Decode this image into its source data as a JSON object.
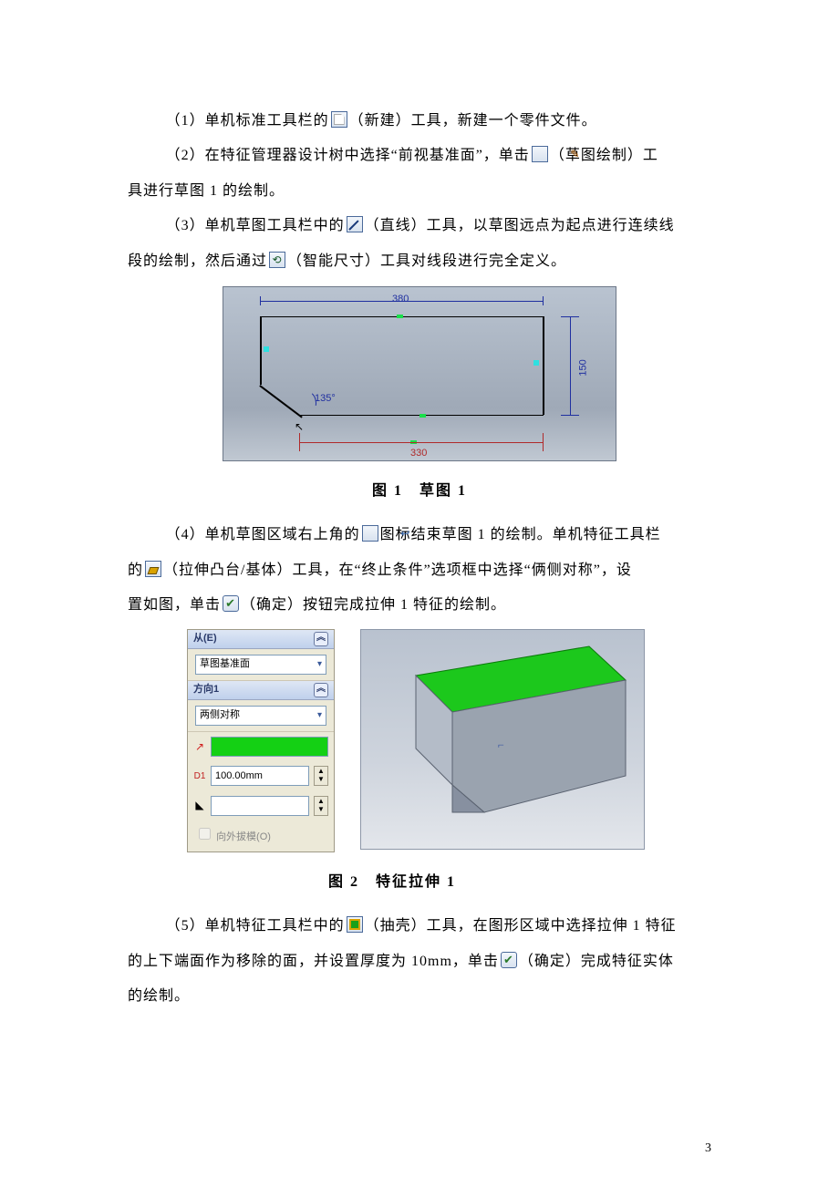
{
  "step1": {
    "prefix": "（1）单机标准工具栏的",
    "icon_tool_name": "（新建）工具，新建一个零件文件。"
  },
  "step2": {
    "line1_a": "（2）在特征管理器设计树中选择“前视基准面”，单击",
    "line1_b": "（草图绘制）工",
    "line2": "具进行草图 1 的绘制。"
  },
  "step3": {
    "line1_a": "（3）单机草图工具栏中的",
    "line1_b": "（直线）工具，以草图远点为起点进行连续线",
    "line2_a": "段的绘制，然后通过",
    "line2_b": "（智能尺寸）工具对线段进行完全定义。"
  },
  "sketch1": {
    "dim_top": "380",
    "dim_right": "150",
    "dim_bottom": "330",
    "angle": "135°",
    "caption": "图 1　草图 1"
  },
  "step4": {
    "line1_a": "（4）单机草图区域右上角的",
    "line1_b": "图标结束草图 1 的绘制。单机特征工具栏",
    "line2_a": "的",
    "line2_b": "（拉伸凸台/基体）工具，在“终止条件”选项框中选择“俩侧对称”，设",
    "line3_a": "置如图，单击",
    "line3_b": "（确定）按钮完成拉伸 1 特征的绘制。"
  },
  "panel": {
    "hdr_from": "从(E)",
    "from_value": "草图基准面",
    "hdr_dir": "方向1",
    "dir_value": "两侧对称",
    "depth_label": "D1",
    "depth_value": "100.00mm",
    "draft_chk": "向外拔模(O)"
  },
  "fig2_caption": "图 2　特征拉伸 1",
  "step5": {
    "line1_a": "（5）单机特征工具栏中的",
    "line1_b": "（抽壳）工具，在图形区域中选择拉伸 1 特征",
    "line2_a": "的上下端面作为移除的面，并设置厚度为 10mm，单击",
    "line2_b": "（确定）完成特征实体",
    "line3": "的绘制。"
  },
  "page_number": "3"
}
